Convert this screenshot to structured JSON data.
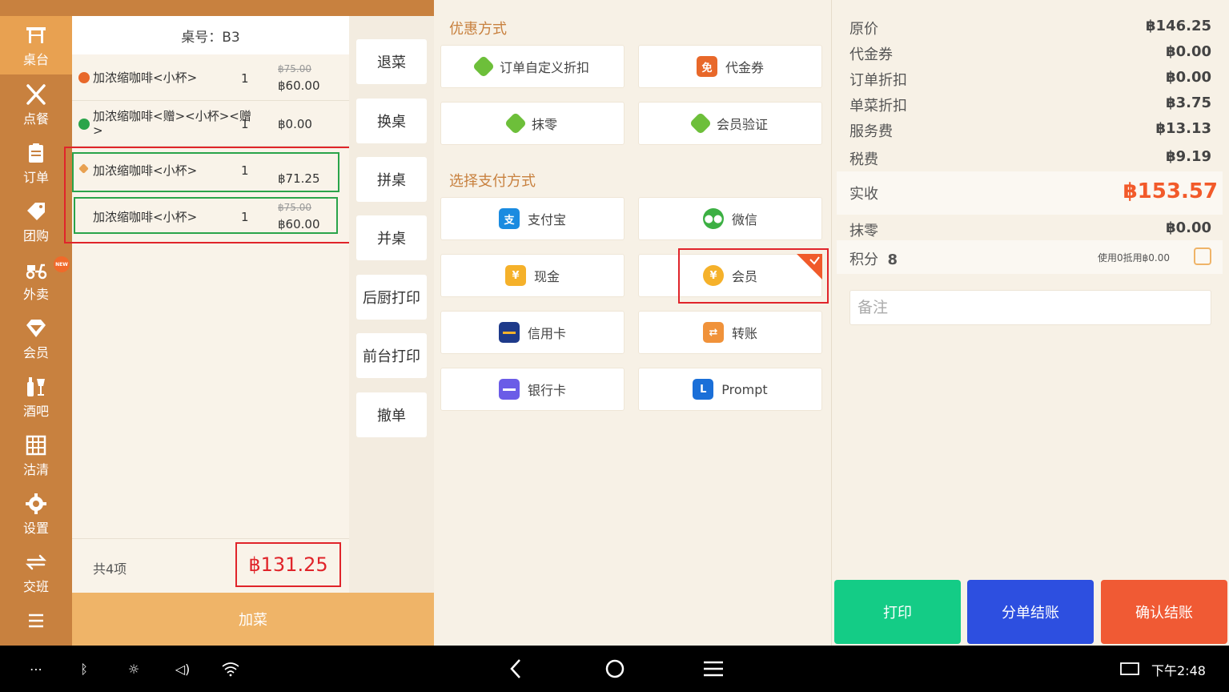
{
  "sidebar": {
    "items": [
      {
        "label": "桌台",
        "icon": "table-icon",
        "active": true
      },
      {
        "label": "点餐",
        "icon": "fork-knife-icon"
      },
      {
        "label": "订单",
        "icon": "clipboard-icon"
      },
      {
        "label": "团购",
        "icon": "tag-icon"
      },
      {
        "label": "外卖",
        "icon": "scooter-icon",
        "badge": "NEW"
      },
      {
        "label": "会员",
        "icon": "diamond-icon"
      },
      {
        "label": "酒吧",
        "icon": "bottle-glass-icon"
      },
      {
        "label": "沽清",
        "icon": "grid-icon"
      },
      {
        "label": "设置",
        "icon": "gear-icon"
      },
      {
        "label": "交班",
        "icon": "swap-icon"
      }
    ]
  },
  "order": {
    "table_label": "桌号：B3",
    "items": [
      {
        "name": "加浓缩咖啡<小杯>",
        "qty": "1",
        "orig_price": "฿75.00",
        "price": "฿60.00",
        "status_icon": "cancel-icon"
      },
      {
        "name_line1": "加浓缩咖啡<赠><小杯><赠",
        "name_line2": ">",
        "qty": "1",
        "price": "฿0.00",
        "status_icon": "gift-icon"
      },
      {
        "name": "加浓缩咖啡<小杯>",
        "qty": "1",
        "price": "฿71.25",
        "status_icon": "discount-tag-icon"
      },
      {
        "name": "加浓缩咖啡<小杯>",
        "qty": "1",
        "orig_price": "฿75.00",
        "price": "฿60.00"
      }
    ],
    "count_label": "共4项",
    "total": "฿131.25",
    "add_label": "加菜"
  },
  "actions": [
    "退菜",
    "换桌",
    "拼桌",
    "并桌",
    "后厨打印",
    "前台打印",
    "撤单"
  ],
  "payment": {
    "discount_title": "优惠方式",
    "discounts": [
      {
        "label": "订单自定义折扣",
        "icon": "tag-icon",
        "color": "#6dbf3a"
      },
      {
        "label": "代金券",
        "icon": "voucher-icon",
        "color": "#e8682a",
        "glyph": "免"
      },
      {
        "label": "抹零",
        "icon": "tag-icon",
        "color": "#6dbf3a"
      },
      {
        "label": "会员验证",
        "icon": "tag-icon",
        "color": "#6dbf3a"
      }
    ],
    "method_title": "选择支付方式",
    "methods": [
      {
        "label": "支付宝",
        "icon": "alipay-icon",
        "color": "#1a8be0",
        "glyph": "支"
      },
      {
        "label": "微信",
        "icon": "wechat-icon",
        "color": "#3cb043"
      },
      {
        "label": "现金",
        "icon": "cash-icon",
        "color": "#f5b12a",
        "glyph": "¥"
      },
      {
        "label": "会员",
        "icon": "member-icon",
        "color": "#f5b12a",
        "glyph": "¥",
        "selected": true
      },
      {
        "label": "信用卡",
        "icon": "credit-card-icon",
        "color": "#1e3a8a"
      },
      {
        "label": "转账",
        "icon": "transfer-icon",
        "color": "#f0923a"
      },
      {
        "label": "银行卡",
        "icon": "bank-card-icon",
        "color": "#6b5ce7"
      },
      {
        "label": "Prompt",
        "icon": "prompt-icon",
        "color": "#1a6fd8",
        "glyph": "L"
      }
    ]
  },
  "summary": {
    "rows": [
      {
        "label": "原价",
        "value": "฿146.25"
      },
      {
        "label": "代金券",
        "value": "฿0.00"
      },
      {
        "label": "订单折扣",
        "value": "฿0.00"
      },
      {
        "label": "单菜折扣",
        "value": "฿3.75"
      },
      {
        "label": "服务费",
        "value": "฿13.13"
      },
      {
        "label": "税费",
        "value": "฿9.19"
      }
    ],
    "actual_label": "实收",
    "actual_value": "฿153.57",
    "rounding_label": "抹零",
    "rounding_value": "฿0.00",
    "points_label": "积分",
    "points_value": "8",
    "points_hint": "使用0抵用฿0.00",
    "remark_placeholder": "备注",
    "buttons": {
      "print": "打印",
      "split": "分单结账",
      "confirm": "确认结账"
    },
    "colors": {
      "print": "#14cc86",
      "split": "#2d4fe0",
      "confirm": "#f05a34"
    }
  },
  "system": {
    "clock": "下午2:48"
  }
}
